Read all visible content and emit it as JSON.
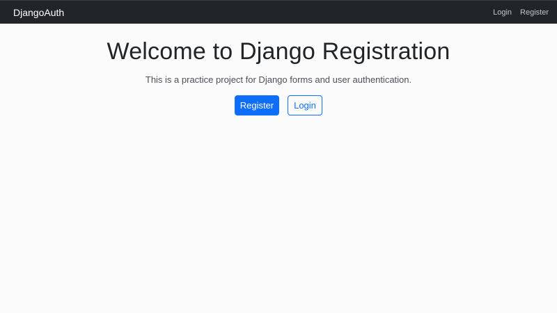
{
  "navbar": {
    "brand": "DjangoAuth",
    "links": [
      {
        "label": "Login"
      },
      {
        "label": "Register"
      }
    ]
  },
  "hero": {
    "title": "Welcome to Django Registration",
    "lead": "This is a practice project for Django forms and user authentication.",
    "primary_button": "Register",
    "secondary_button": "Login"
  },
  "colors": {
    "navbar_bg": "#212529",
    "primary": "#0d6efd",
    "page_bg": "#fcfbfc"
  }
}
